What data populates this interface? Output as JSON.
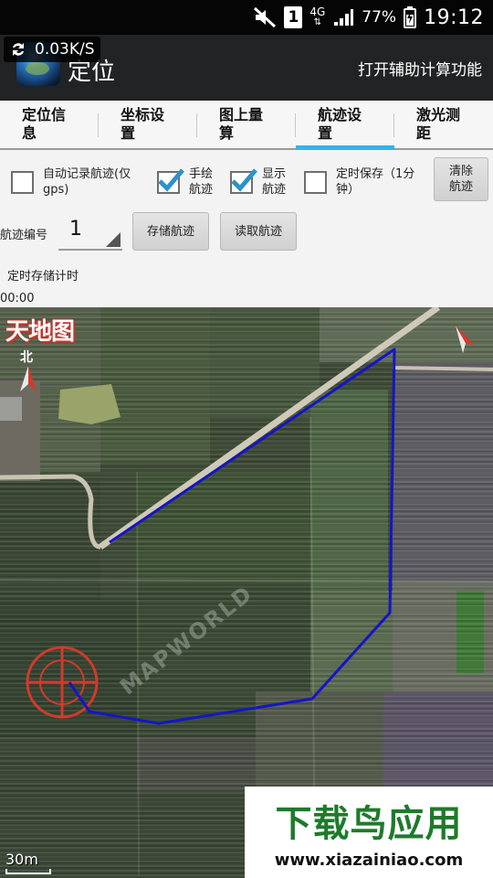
{
  "status_bar": {
    "network_type": "4G",
    "battery_percent": "77%",
    "time": "19:12",
    "sim_label": "1",
    "icons": [
      "mute-icon",
      "sim-icon",
      "signal-icon",
      "battery-icon"
    ]
  },
  "action_bar": {
    "title": "定位",
    "net_speed": "0.03K/S",
    "aux_button": "打开辅助计算功能"
  },
  "tabs": [
    {
      "line1": "定位信",
      "line2": "息",
      "active": false
    },
    {
      "line1": "坐标设",
      "line2": "置",
      "active": false
    },
    {
      "line1": "图上量",
      "line2": "算",
      "active": false
    },
    {
      "line1": "航迹设",
      "line2": "置",
      "active": true
    },
    {
      "line1": "激光测",
      "line2": "距",
      "active": false
    }
  ],
  "options": {
    "auto_record": {
      "line1": "自动记录航迹(仅",
      "line2": "gps)",
      "checked": false
    },
    "hand_draw": {
      "line1": "手绘",
      "line2": "航迹",
      "checked": true
    },
    "show_track": {
      "line1": "显示",
      "line2": "航迹",
      "checked": true
    },
    "timed_save": {
      "line1": "定时保存（1分",
      "line2": "钟）",
      "checked": false
    },
    "clear_button": {
      "line1": "清除",
      "line2": "航迹"
    }
  },
  "track": {
    "number_label": "航迹编号",
    "number_value": "1",
    "save_button": "存储航迹",
    "load_button": "读取航迹",
    "timer_label": "定时存储计时",
    "timer_value": "00:00"
  },
  "map": {
    "logo_text": "天地图",
    "north_label": "北",
    "scale_label": "30m",
    "watermark_overlay": "MAPWORLD",
    "track_color": "#1515c8"
  },
  "watermark": {
    "title": "下载鸟应用",
    "url": "www.xiazainiao.com"
  },
  "colors": {
    "accent": "#33b5e5",
    "check": "#2c93c7",
    "action_bar": "#222324"
  }
}
